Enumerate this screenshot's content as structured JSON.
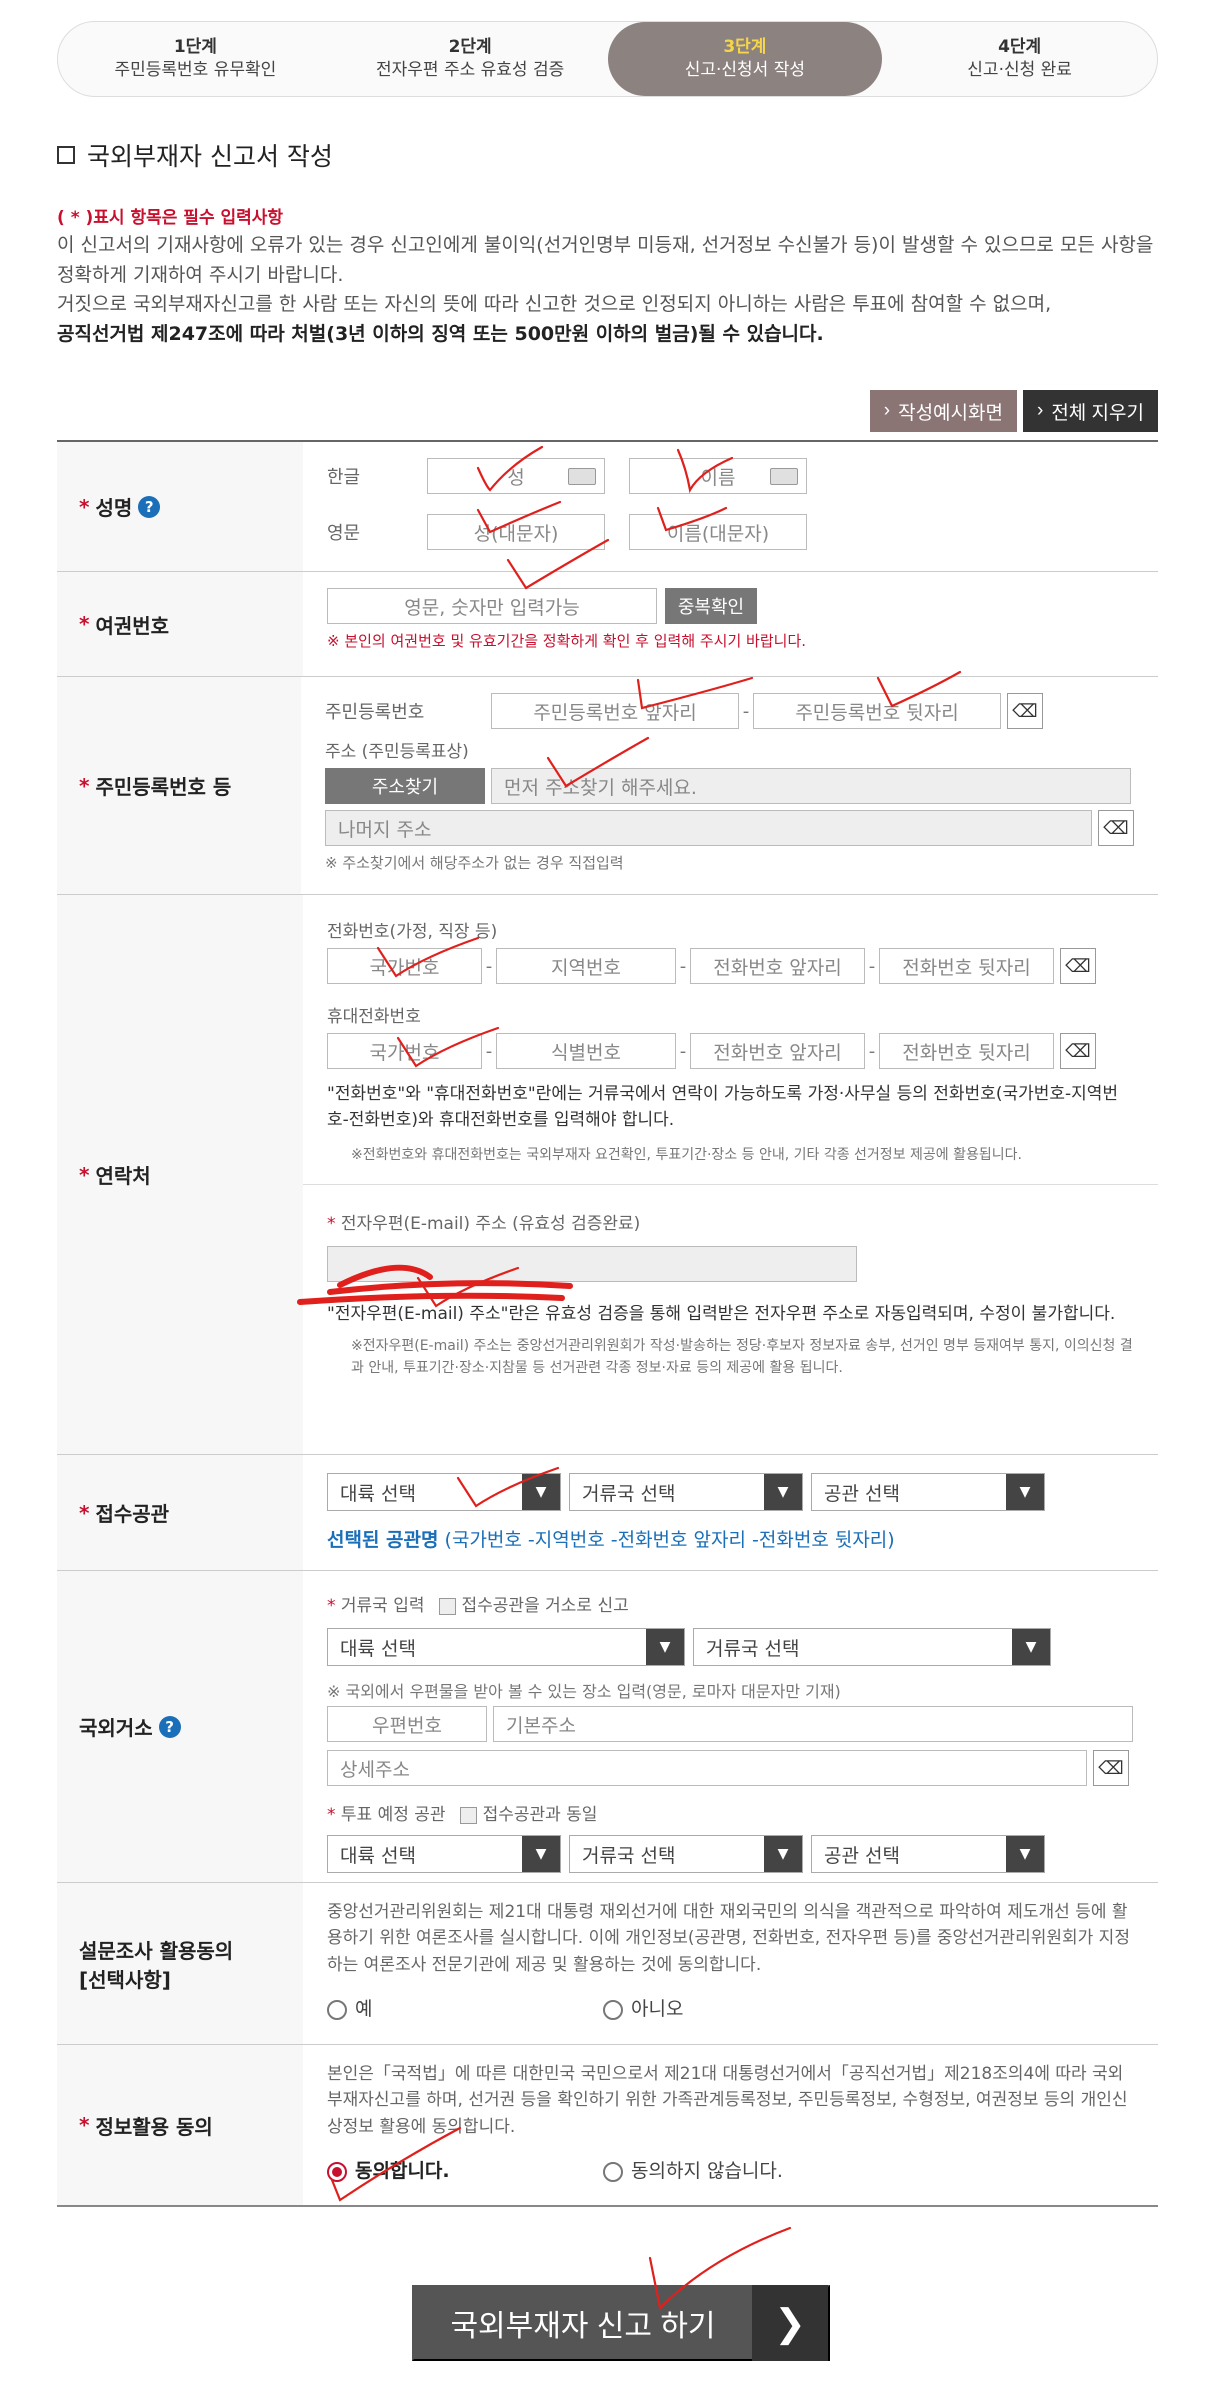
{
  "steps": [
    {
      "num": "1단계",
      "label": "주민등록번호 유무확인"
    },
    {
      "num": "2단계",
      "label": "전자우편 주소 유효성 검증"
    },
    {
      "num": "3단계",
      "label": "신고·신청서 작성"
    },
    {
      "num": "4단계",
      "label": "신고·신청 완료"
    }
  ],
  "page_title": "국외부재자 신고서 작성",
  "notice": {
    "required": "( * )표시 항목은 필수 입력사항",
    "line1": "이 신고서의 기재사항에 오류가 있는 경우 신고인에게 불이익(선거인명부 미등재, 선거정보 수신불가 등)이 발생할 수 있으므로 모든 사항을 정확하게 기재하여 주시기 바랍니다.",
    "line2": "거짓으로 국외부재자신고를 한 사람 또는 자신의 뜻에 따라 신고한 것으로 인정되지 아니하는 사람은 투표에 참여할 수 없으며,",
    "line3": "공직선거법 제247조에 따라 처벌(3년 이하의 징역 또는 500만원 이하의 벌금)될 수 있습니다."
  },
  "buttons": {
    "example": "작성예시화면",
    "clear_all": "전체 지우기"
  },
  "name": {
    "label": "성명",
    "korean": "한글",
    "english": "영문",
    "surname_ph": "성",
    "given_ph": "이름",
    "surname_en_ph": "성(대문자)",
    "given_en_ph": "이름(대문자)"
  },
  "passport": {
    "label": "여권번호",
    "ph": "영문, 숫자만 입력가능",
    "check": "중복확인",
    "warn": "※ 본인의 여권번호 및 유효기간을 정확하게 확인 후 입력해 주시기 바랍니다."
  },
  "resident": {
    "label": "주민등록번호 등",
    "rrn": "주민등록번호",
    "front_ph": "주민등록번호 앞자리",
    "back_ph": "주민등록번호 뒷자리",
    "address_title": "주소 (주민등록표상)",
    "find": "주소찾기",
    "find_ph": "먼저 주소찾기 해주세요.",
    "rest_ph": "나머지 주소",
    "note": "※ 주소찾기에서 해당주소가 없는 경우 직접입력"
  },
  "contact": {
    "label": "연락처",
    "phone_title": "전화번호(가정, 직장 등)",
    "country_ph": "국가번호",
    "area_ph": "지역번호",
    "front_ph": "전화번호 앞자리",
    "back_ph": "전화번호 뒷자리",
    "mobile_title": "휴대전화번호",
    "id_ph": "식별번호",
    "desc1": "\"전화번호\"와 \"휴대전화번호\"란에는 거류국에서 연락이 가능하도록 가정·사무실 등의 전화번호(국가번호-지역번호-전화번호)와 휴대전화번호를 입력해야 합니다.",
    "note1": "※전화번호와 휴대전화번호는 국외부재자 요건확인, 투표기간·장소 등 안내, 기타 각종 선거정보 제공에 활용됩니다.",
    "email_title": "전자우편(E-mail) 주소 (유효성 검증완료)",
    "desc2": "\"전자우편(E-mail) 주소\"란은 유효성 검증을 통해 입력받은 전자우편 주소로 자동입력되며, 수정이 불가합니다.",
    "note2": "※전자우편(E-mail) 주소는 중앙선거관리위원회가 작성·발송하는 정당·후보자 정보자료 송부, 선거인 명부 등재여부 통지, 이의신청 결과 안내, 투표기간·장소·지참물 등 선거관련 각종 정보·자료 등의 제공에 활용 됩니다."
  },
  "office": {
    "label": "접수공관",
    "continent": "대륙 선택",
    "country": "거류국 선택",
    "mission": "공관 선택",
    "selected": "선택된 공관명",
    "selected_fmt": "(국가번호 -지역번호 -전화번호 앞자리 -전화번호 뒷자리)"
  },
  "overseas": {
    "label": "국외거소",
    "country_input": "거류국 입력",
    "as_office": "접수공관을 거소로 신고",
    "continent": "대륙 선택",
    "country": "거류국 선택",
    "mail_note": "※ 국외에서 우편물을 받아 볼 수 있는 장소 입력(영문, 로마자 대문자만 기재)",
    "zip_ph": "우편번호",
    "addr_ph": "기본주소",
    "detail_ph": "상세주소",
    "vote_office": "투표 예정 공관",
    "same_office": "접수공관과 동일",
    "mission": "공관 선택"
  },
  "survey": {
    "label": "설문조사 활용동의",
    "label2": "[선택사항]",
    "desc": "중앙선거관리위원회는 제21대 대통령 재외선거에 대한 재외국민의 의식을 객관적으로 파악하여 제도개선 등에 활용하기 위한 여론조사를 실시합니다. 이에 개인정보(공관명, 전화번호, 전자우편 등)를 중앙선거관리위원회가 지정하는 여론조사 전문기관에 제공 및 활용하는 것에 동의합니다.",
    "yes": "예",
    "no": "아니오"
  },
  "consent": {
    "label": "정보활용 동의",
    "desc": "본인은「국적법」에 따른 대한민국 국민으로서 제21대 대통령선거에서「공직선거법」제218조의4에 따라 국외부재자신고를 하며, 선거권 등을 확인하기 위한 가족관계등록정보, 주민등록정보, 수형정보, 여권정보 등의 개인신상정보 활용에 동의합니다.",
    "agree": "동의합니다.",
    "disagree": "동의하지 않습니다."
  },
  "submit": "국외부재자 신고 하기",
  "colors": {
    "accent": "#c8102e",
    "active_step": "#8c8280",
    "blue": "#1a6fb8"
  }
}
